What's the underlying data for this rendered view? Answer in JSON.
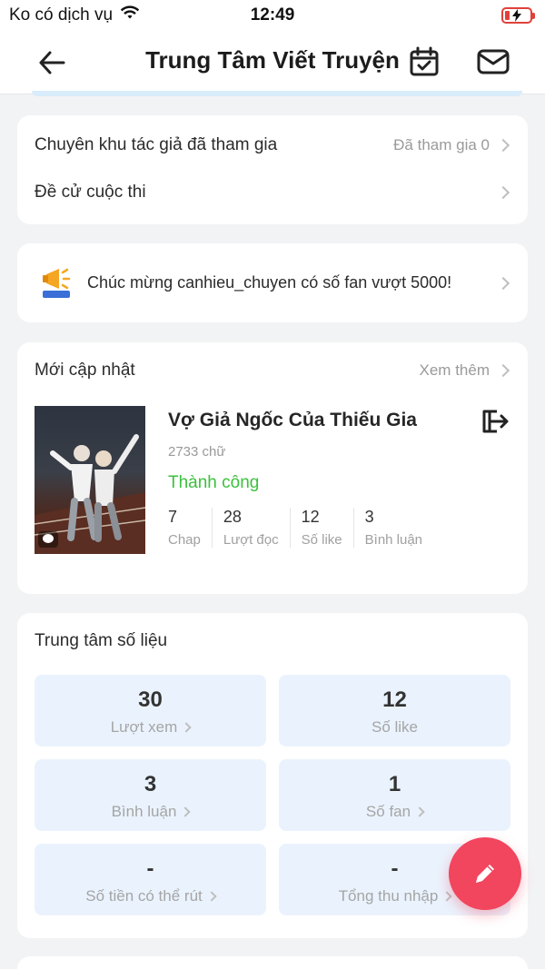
{
  "status_bar": {
    "carrier": "Ko có dịch vụ",
    "time": "12:49"
  },
  "header": {
    "title": "Trung Tâm Viết Truyện"
  },
  "participation": {
    "author_zone_label": "Chuyên khu tác giả đã tham gia",
    "author_zone_value": "Đã tham gia 0",
    "contest_label": "Đề cử cuộc thi"
  },
  "announcement": {
    "text": "Chúc mừng canhieu_chuyen có số fan vượt 5000!"
  },
  "latest": {
    "heading": "Mới cập nhật",
    "more_label": "Xem thêm",
    "book": {
      "title": "Vợ Giả Ngốc Của Thiếu Gia",
      "word_count": "2733 chữ",
      "status": "Thành công",
      "stats": [
        {
          "value": "7",
          "label": "Chap"
        },
        {
          "value": "28",
          "label": "Lượt đọc"
        },
        {
          "value": "12",
          "label": "Số like"
        },
        {
          "value": "3",
          "label": "Bình luận"
        }
      ]
    }
  },
  "data_center": {
    "heading": "Trung tâm số liệu",
    "tiles": [
      {
        "value": "30",
        "label": "Lượt xem",
        "has_arrow": true
      },
      {
        "value": "12",
        "label": "Số like",
        "has_arrow": false
      },
      {
        "value": "3",
        "label": "Bình luận",
        "has_arrow": true
      },
      {
        "value": "1",
        "label": "Số fan",
        "has_arrow": true
      },
      {
        "value": "-",
        "label": "Số tiền có thể rút",
        "has_arrow": true
      },
      {
        "value": "-",
        "label": "Tổng thu nhập",
        "has_arrow": true
      }
    ]
  },
  "colors": {
    "accent_fab": "#f2455e",
    "success": "#3cc03c",
    "tile_bg": "#eaf3fd"
  },
  "icons": {
    "back": "arrow-left-icon",
    "calendar": "calendar-check-icon",
    "mail": "mail-icon",
    "megaphone": "megaphone-icon",
    "exit": "exit-icon",
    "fab": "pencil-icon"
  }
}
